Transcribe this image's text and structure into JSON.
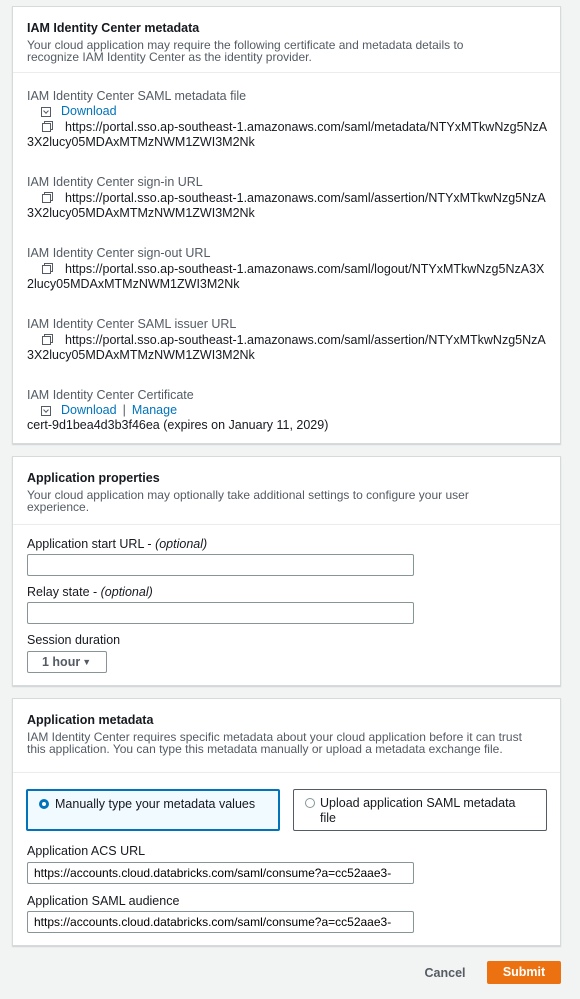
{
  "idc_metadata": {
    "title": "IAM Identity Center metadata",
    "description": "Your cloud application may require the following certificate and metadata details to recognize IAM Identity Center as the identity provider.",
    "saml_file_label": "IAM Identity Center SAML metadata file",
    "saml_file_download": "Download",
    "saml_file_url": "https://portal.sso.ap-southeast-1.amazonaws.com/saml/metadata/NTYxMTkwNzg5NzA3X2lucy05MDAxMTMzNWM1ZWI3M2Nk",
    "signin_label": "IAM Identity Center sign-in URL",
    "signin_url": "https://portal.sso.ap-southeast-1.amazonaws.com/saml/assertion/NTYxMTkwNzg5NzA3X2lucy05MDAxMTMzNWM1ZWI3M2Nk",
    "signout_label": "IAM Identity Center sign-out URL",
    "signout_url": "https://portal.sso.ap-southeast-1.amazonaws.com/saml/logout/NTYxMTkwNzg5NzA3X2lucy05MDAxMTMzNWM1ZWI3M2Nk",
    "issuer_label": "IAM Identity Center SAML issuer URL",
    "issuer_url": "https://portal.sso.ap-southeast-1.amazonaws.com/saml/assertion/NTYxMTkwNzg5NzA3X2lucy05MDAxMTMzNWM1ZWI3M2Nk",
    "certificate_label": "IAM Identity Center Certificate",
    "certificate_download": "Download",
    "certificate_separator": "|",
    "certificate_manage": "Manage",
    "certificate_text": "cert-9d1bea4d3b3f46ea (expires on January 11, 2029)"
  },
  "app_properties": {
    "title": "Application properties",
    "description": "Your cloud application may optionally take additional settings to configure your user experience.",
    "start_url_label": "Application start URL - ",
    "start_url_optional": "(optional)",
    "start_url_value": "",
    "relay_label": "Relay state - ",
    "relay_optional": "(optional)",
    "relay_value": "",
    "session_label": "Session duration",
    "session_value": "1 hour"
  },
  "app_metadata": {
    "title": "Application metadata",
    "description": "IAM Identity Center requires specific metadata about your cloud application before it can trust this application. You can type this metadata manually or upload a metadata exchange file.",
    "option_manual": "Manually type your metadata values",
    "option_upload": "Upload application SAML metadata file",
    "acs_label": "Application ACS URL",
    "acs_value": "https://accounts.cloud.databricks.com/saml/consume?a=cc52aae3-",
    "audience_label": "Application SAML audience",
    "audience_value": "https://accounts.cloud.databricks.com/saml/consume?a=cc52aae3-"
  },
  "footer": {
    "cancel": "Cancel",
    "submit": "Submit"
  },
  "colors": {
    "link": "#0073bb",
    "primary_button": "#ec7211",
    "page_bg": "#f2f3f3"
  },
  "icons": [
    "copy-icon",
    "download-icon",
    "dropdown-caret-icon"
  ]
}
